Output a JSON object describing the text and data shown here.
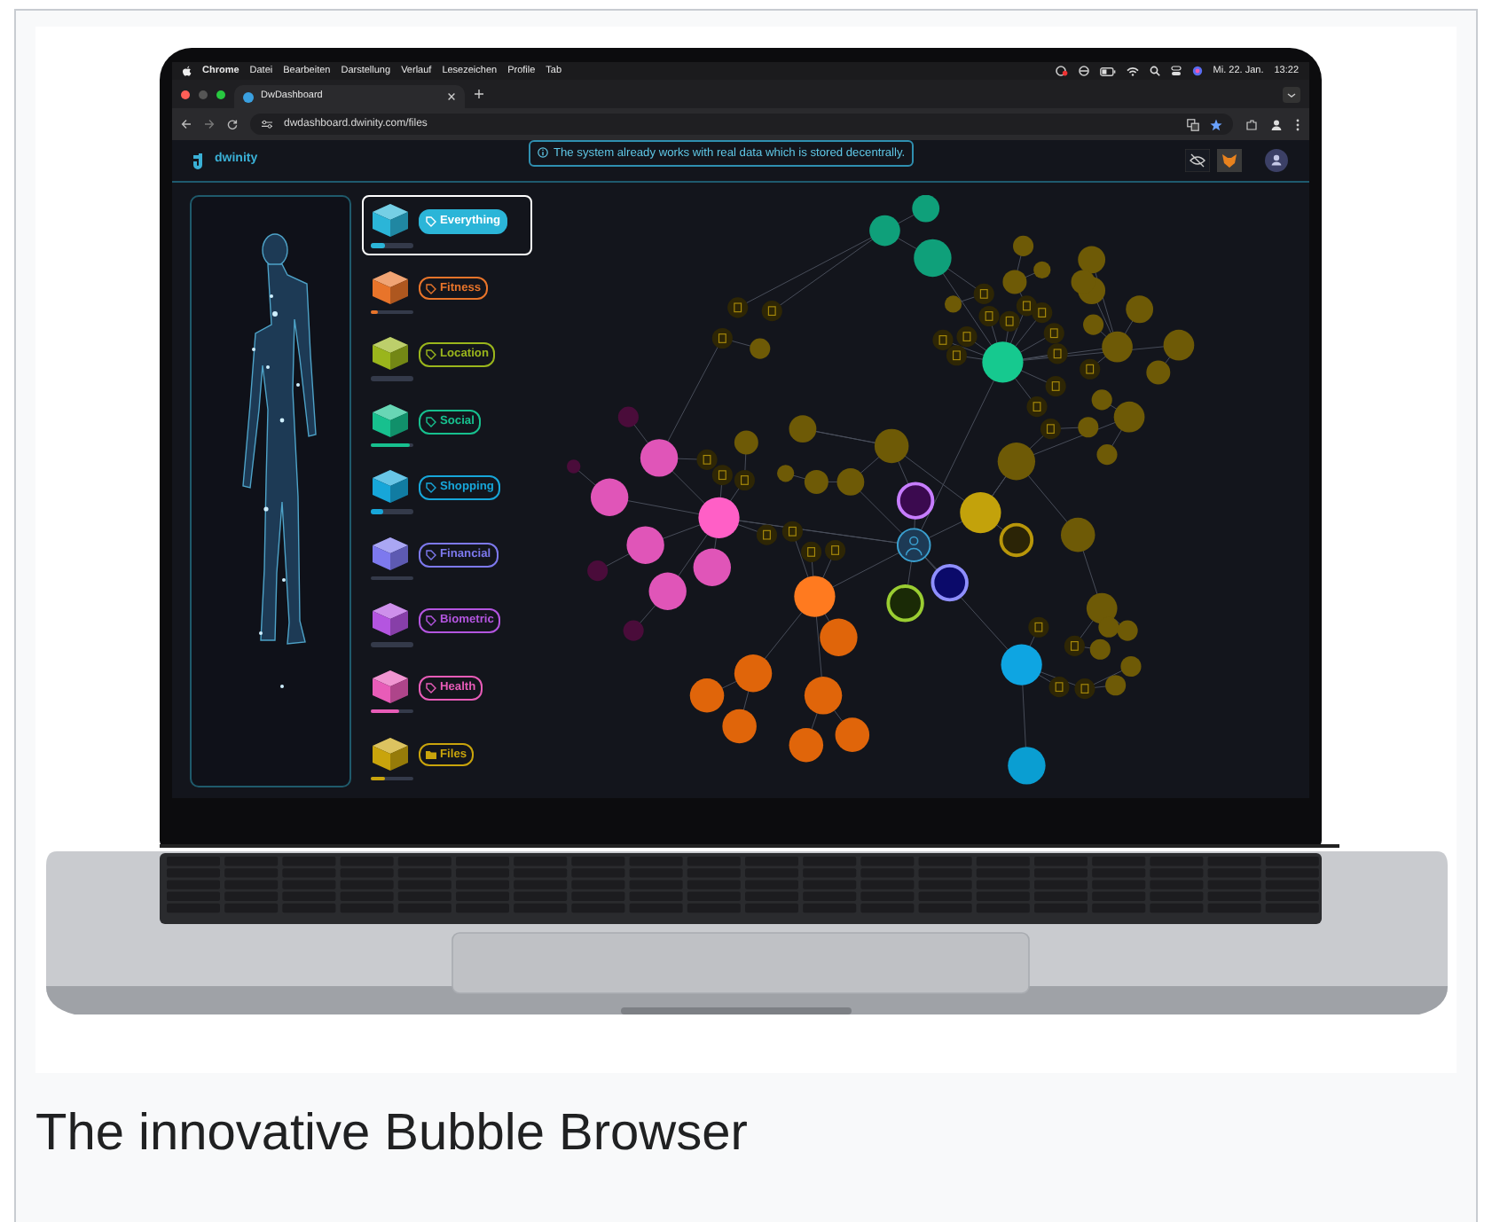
{
  "menu_bar": {
    "app": "Chrome",
    "items": [
      "Datei",
      "Bearbeiten",
      "Darstellung",
      "Verlauf",
      "Lesezeichen",
      "Profile",
      "Tab"
    ],
    "date": "Mi. 22. Jan.",
    "time": "13:22"
  },
  "tabs": [
    {
      "title": "DwDashboard"
    }
  ],
  "address_bar": {
    "url": "dwdashboard.dwinity.com/files"
  },
  "app_header": {
    "logo": "dwinity",
    "notice": "The system already works with real data which is stored decentrally."
  },
  "categories": [
    {
      "label": "Everything",
      "kind": "tag",
      "color": "#2bb5d8",
      "level": 0.35,
      "selected": true
    },
    {
      "label": "Fitness",
      "kind": "tag",
      "color": "#e8742a",
      "level": 0.15,
      "selected": false
    },
    {
      "label": "Location",
      "kind": "tag",
      "color": "#9ab51c",
      "level": 0,
      "selected": false
    },
    {
      "label": "Social",
      "kind": "tag",
      "color": "#17c08e",
      "level": 0.9,
      "selected": false
    },
    {
      "label": "Shopping",
      "kind": "tag",
      "color": "#17a6d9",
      "level": 0.3,
      "selected": false
    },
    {
      "label": "Financial",
      "kind": "tag",
      "color": "#7d79ee",
      "level": 0,
      "selected": false
    },
    {
      "label": "Biometric",
      "kind": "tag",
      "color": "#b455e0",
      "level": 0,
      "selected": false
    },
    {
      "label": "Health",
      "kind": "tag",
      "color": "#e85cb8",
      "level": 0.65,
      "selected": false
    },
    {
      "label": "Files",
      "kind": "folder",
      "color": "#c9a40c",
      "level": 0.35,
      "selected": false
    }
  ],
  "caption": "The innovative Bubble Browser"
}
